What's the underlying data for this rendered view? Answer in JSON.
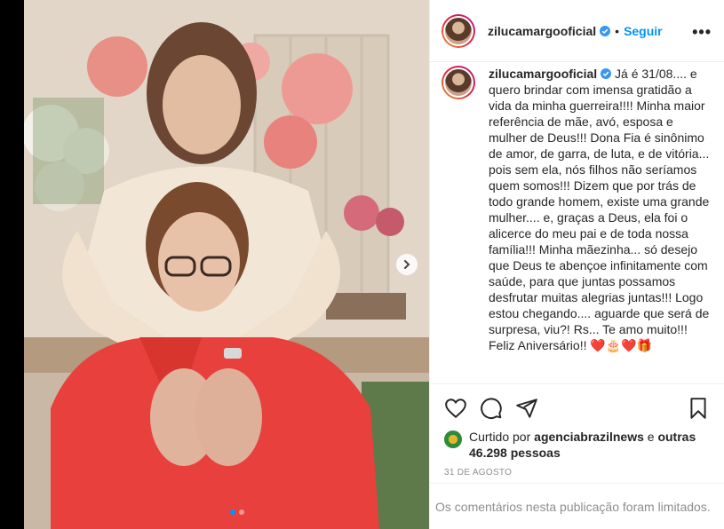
{
  "post": {
    "username": "zilucamargooficial",
    "separator": "•",
    "follow_label": "Seguir",
    "more_label": "•••"
  },
  "caption": {
    "username": "zilucamargooficial",
    "text": "Já é 31/08.... e quero brindar com imensa gratidão a vida da minha guerreira!!!! Minha maior referência de mãe, avó, esposa e mulher de Deus!!! Dona Fia é sinônimo de amor, de garra, de luta, e de vitória... pois sem ela, nós filhos não seríamos quem somos!!! Dizem que por trás de todo grande homem, existe uma grande mulher.... e, graças a Deus, ela foi o alicerce do meu pai e de toda nossa família!!! Minha mãezinha... só desejo que Deus te abençoe infinitamente com saúde, para que juntas possamos desfrutar muitas alegrias juntas!!! Logo estou chegando.... aguarde que será de surpresa, viu?! Rs... Te amo muito!!! Feliz Aniversário!!",
    "emoji": "❤️🎂❤️🎁"
  },
  "likes": {
    "prefix": "Curtido por",
    "user": "agenciabrazilnews",
    "middle": "e",
    "others": "outras 46.298 pessoas"
  },
  "date": "31 DE AGOSTO",
  "comments_limited": "Os comentários nesta publicação foram limitados.",
  "carousel": {
    "current": 1,
    "total": 2
  },
  "icons": [
    "heart-icon",
    "comment-icon",
    "share-icon",
    "save-icon",
    "verified-badge-icon",
    "next-arrow-icon"
  ],
  "colors": {
    "link": "#0095f6",
    "text": "#262626",
    "muted": "#8e8e8e",
    "border": "#efefef"
  }
}
